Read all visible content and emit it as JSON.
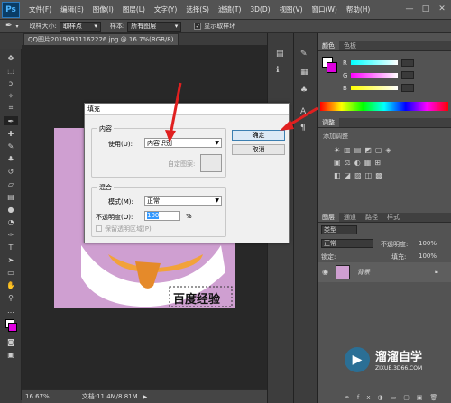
{
  "menubar": {
    "logo": "Ps",
    "items": [
      "文件(F)",
      "编辑(E)",
      "图像(I)",
      "图层(L)",
      "文字(Y)",
      "选择(S)",
      "滤镜(T)",
      "3D(D)",
      "视图(V)",
      "窗口(W)",
      "帮助(H)"
    ]
  },
  "window_controls": [
    "—",
    "□",
    "✕"
  ],
  "options": {
    "sample_size_label": "取样大小:",
    "sample_size_value": "取样点",
    "sample_label": "样本:",
    "sample_value": "所有图层",
    "show_ring_label": "显示取样环"
  },
  "document": {
    "tab_title": "QQ图片20190911162226.jpg @ 16.7%(RGB/8) *",
    "canvas_text": "百度经验",
    "canvas_color": "#cf9fd1"
  },
  "status": {
    "zoom": "16.67%",
    "doc_info": "文档:11.4M/8.81M"
  },
  "color_panel": {
    "tabs": [
      "颜色",
      "色板"
    ],
    "labels": [
      "R",
      "G",
      "B"
    ]
  },
  "adjust_panel": {
    "tab": "调整",
    "label": "添加调整"
  },
  "layers_panel": {
    "tabs": [
      "图层",
      "通道",
      "路径",
      "样式"
    ],
    "filter_label": "类型",
    "blend_mode": "正常",
    "opacity_label": "不透明度:",
    "opacity_value": "100%",
    "lock_label": "锁定:",
    "fill_label": "填充:",
    "fill_value": "100%",
    "layer_name": "背景"
  },
  "fill_dialog": {
    "title": "填充",
    "content_group": "内容",
    "use_label": "使用(U):",
    "use_value": "内容识别",
    "custom_pattern_label": "自定图案:",
    "blend_group": "混合",
    "mode_label": "模式(M):",
    "mode_value": "正常",
    "opacity_label": "不透明度(O):",
    "opacity_value": "100",
    "percent": "%",
    "preserve_label": "保留透明区域(P)",
    "ok_label": "确定",
    "cancel_label": "取消"
  },
  "watermark": {
    "name": "溜溜自学",
    "url": "ZIXUE.3D66.COM"
  }
}
